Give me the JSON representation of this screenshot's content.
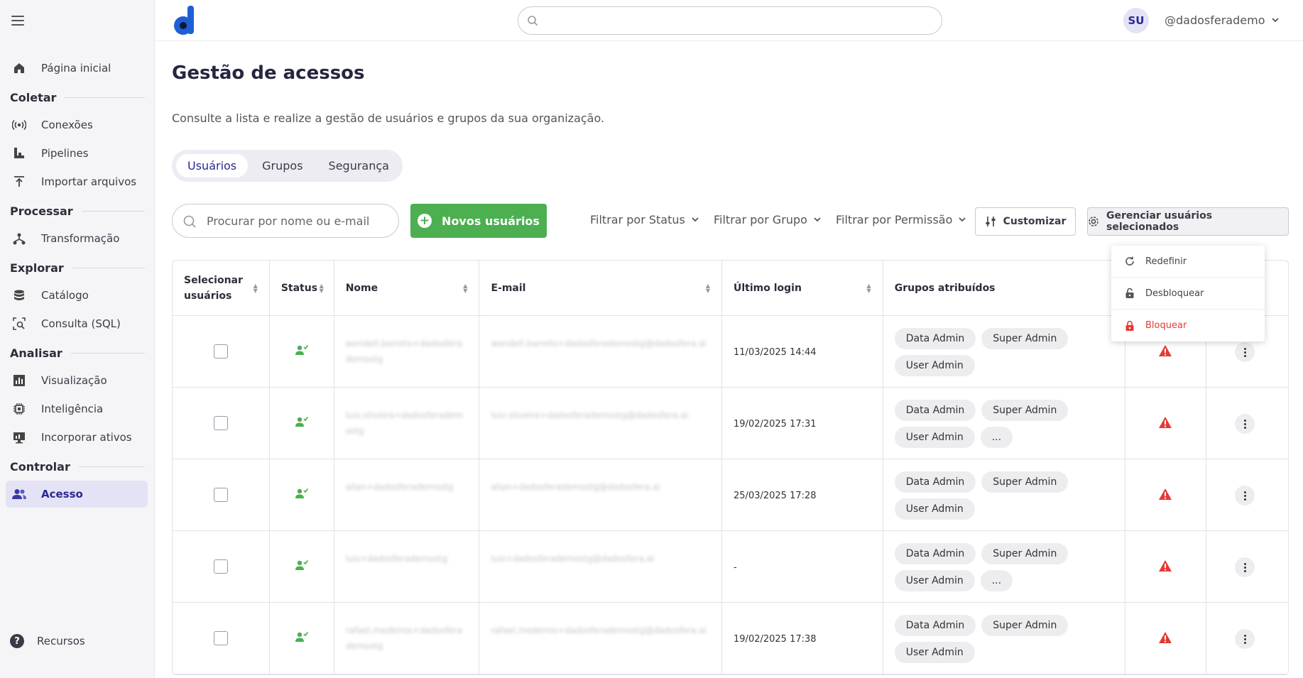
{
  "app": {
    "logo_letter": "d"
  },
  "sidebar": {
    "items": [
      {
        "type": "item",
        "label": "Página inicial",
        "icon": "home-icon"
      },
      {
        "type": "section",
        "label": "Coletar"
      },
      {
        "type": "item",
        "label": "Conexões",
        "icon": "connections-icon"
      },
      {
        "type": "item",
        "label": "Pipelines",
        "icon": "pipelines-icon"
      },
      {
        "type": "item",
        "label": "Importar arquivos",
        "icon": "upload-icon"
      },
      {
        "type": "section",
        "label": "Processar"
      },
      {
        "type": "item",
        "label": "Transformação",
        "icon": "transform-icon"
      },
      {
        "type": "section",
        "label": "Explorar"
      },
      {
        "type": "item",
        "label": "Catálogo",
        "icon": "database-icon"
      },
      {
        "type": "item",
        "label": "Consulta (SQL)",
        "icon": "query-icon"
      },
      {
        "type": "section",
        "label": "Analisar"
      },
      {
        "type": "item",
        "label": "Visualização",
        "icon": "chart-icon"
      },
      {
        "type": "item",
        "label": "Inteligência",
        "icon": "chip-icon"
      },
      {
        "type": "item",
        "label": "Incorporar ativos",
        "icon": "embed-icon"
      },
      {
        "type": "section",
        "label": "Controlar"
      },
      {
        "type": "item",
        "label": "Acesso",
        "icon": "users-icon",
        "active": true
      }
    ],
    "bottom_label": "Recursos"
  },
  "header": {
    "search_placeholder": "",
    "avatar_initials": "SU",
    "username": "@dadosferademo"
  },
  "main": {
    "title": "Gestão de acessos",
    "subtitle": "Consulte a lista e realize a gestão de usuários e grupos da sua organização.",
    "tabs": [
      "Usuários",
      "Grupos",
      "Segurança"
    ],
    "active_tab": 0,
    "search_placeholder": "Procurar por nome ou e-mail",
    "new_users_label": "Novos usuários",
    "filters": [
      "Filtrar por Status",
      "Filtrar por Grupo",
      "Filtrar por Permissão"
    ],
    "customize_label": "Customizar",
    "manage_label": "Gerenciar usuários selecionados"
  },
  "dropdown": {
    "items": [
      {
        "label": "Redefinir",
        "icon": "refresh-icon"
      },
      {
        "label": "Desbloquear",
        "icon": "unlock-icon"
      },
      {
        "label": "Bloquear",
        "icon": "lock-icon"
      }
    ]
  },
  "table": {
    "columns": [
      "Selecionar usuários",
      "Status",
      "Nome",
      "E-mail",
      "Último login",
      "Grupos atribuídos"
    ],
    "rows": [
      {
        "name": "wendell.barreto+dadosferademostg",
        "email": "wendell.barreto+dadosferademostg@dadosfera.ai",
        "last_login": "11/03/2025 14:44",
        "groups": [
          "Data Admin",
          "Super Admin",
          "User Admin"
        ]
      },
      {
        "name": "luiz.oliveira+dadosferademostg",
        "email": "luiz.oliveira+dadosferademostg@dadosfera.ai",
        "last_login": "19/02/2025 17:31",
        "groups": [
          "Data Admin",
          "Super Admin",
          "User Admin",
          "..."
        ]
      },
      {
        "name": "allan+dadosferademostg",
        "email": "allan+dadosferademostg@dadosfera.ai",
        "last_login": "25/03/2025 17:28",
        "groups": [
          "Data Admin",
          "Super Admin",
          "User Admin"
        ]
      },
      {
        "name": "luis+dadosferademostg",
        "email": "luis+dadosferademostg@dadosfera.ai",
        "last_login": "-",
        "groups": [
          "Data Admin",
          "Super Admin",
          "User Admin",
          "..."
        ]
      },
      {
        "name": "rafael.medeiros+dadosferademostg",
        "email": "rafael.medeiros+dadosferademostg@dadosfera.ai",
        "last_login": "19/02/2025 17:38",
        "groups": [
          "Data Admin",
          "Super Admin",
          "User Admin"
        ]
      }
    ]
  },
  "colors": {
    "accent": "#2a2891",
    "primary_green": "#4caf50",
    "danger": "#e53935",
    "sidebar_bg": "#f5f5f7"
  }
}
